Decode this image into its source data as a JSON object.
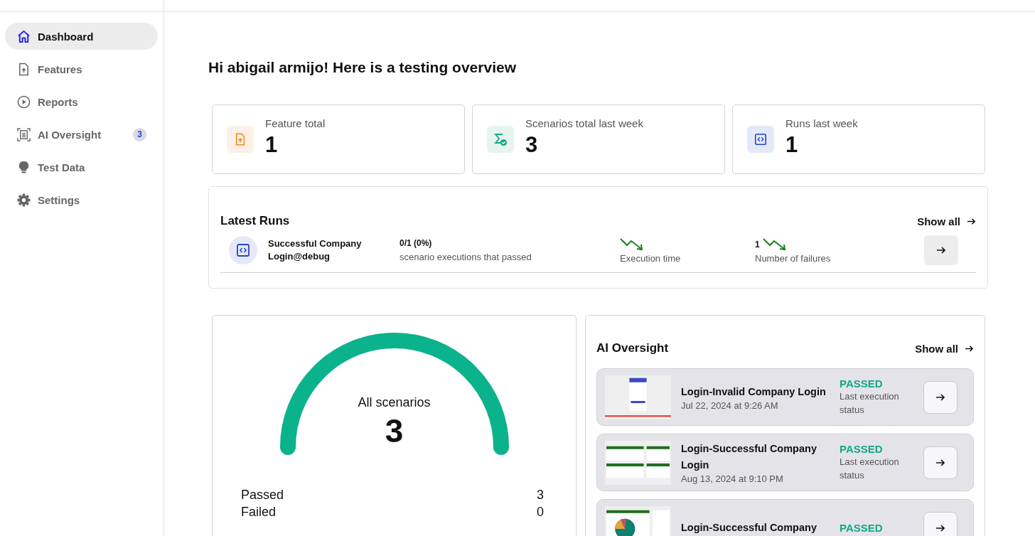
{
  "sidebar": {
    "items": [
      {
        "label": "Dashboard",
        "selected": true,
        "kind": "home"
      },
      {
        "label": "Features",
        "selected": false,
        "kind": "file"
      },
      {
        "label": "Reports",
        "selected": false,
        "kind": "play"
      },
      {
        "label": "AI Oversight",
        "selected": false,
        "kind": "scan",
        "badge": "3"
      },
      {
        "label": "Test Data",
        "selected": false,
        "kind": "bulb"
      },
      {
        "label": "Settings",
        "selected": false,
        "kind": "gear"
      }
    ]
  },
  "greeting": "Hi abigail armijo! Here is a testing overview",
  "stats": [
    {
      "label": "Feature total",
      "value": "1",
      "kind": "feature"
    },
    {
      "label": "Scenarios total last week",
      "value": "3",
      "kind": "scenario"
    },
    {
      "label": "Runs last week",
      "value": "1",
      "kind": "run"
    }
  ],
  "latest_runs": {
    "title": "Latest Runs",
    "show_all": "Show all",
    "rows": [
      {
        "name": "Successful Company Login@debug",
        "ratio": "0/1 (0%)",
        "ratio_label": "scenario executions that passed",
        "time_label": "Execution time",
        "failures": "1",
        "failures_label": "Number of failures"
      }
    ]
  },
  "scenarios": {
    "title": "All scenarios",
    "total": "3",
    "level": 1,
    "rows": [
      {
        "label": "Passed",
        "value": "3"
      },
      {
        "label": "Failed",
        "value": "0"
      }
    ]
  },
  "ai_oversight": {
    "title": "AI Oversight",
    "show_all": "Show all",
    "items": [
      {
        "title": "Login-Invalid Company Login",
        "date": "Jul 22, 2024 at 9:26 AM",
        "status": "PASSED",
        "status_label": "Last execution status",
        "kind": "picture"
      },
      {
        "title": "Login-Successful Company Login",
        "date": "Aug 13, 2024 at 9:10 PM",
        "status": "PASSED",
        "status_label": "Last execution status",
        "kind": "picture"
      },
      {
        "title": "Login-Successful Company",
        "status": "PASSED",
        "kind": "picture"
      }
    ]
  }
}
